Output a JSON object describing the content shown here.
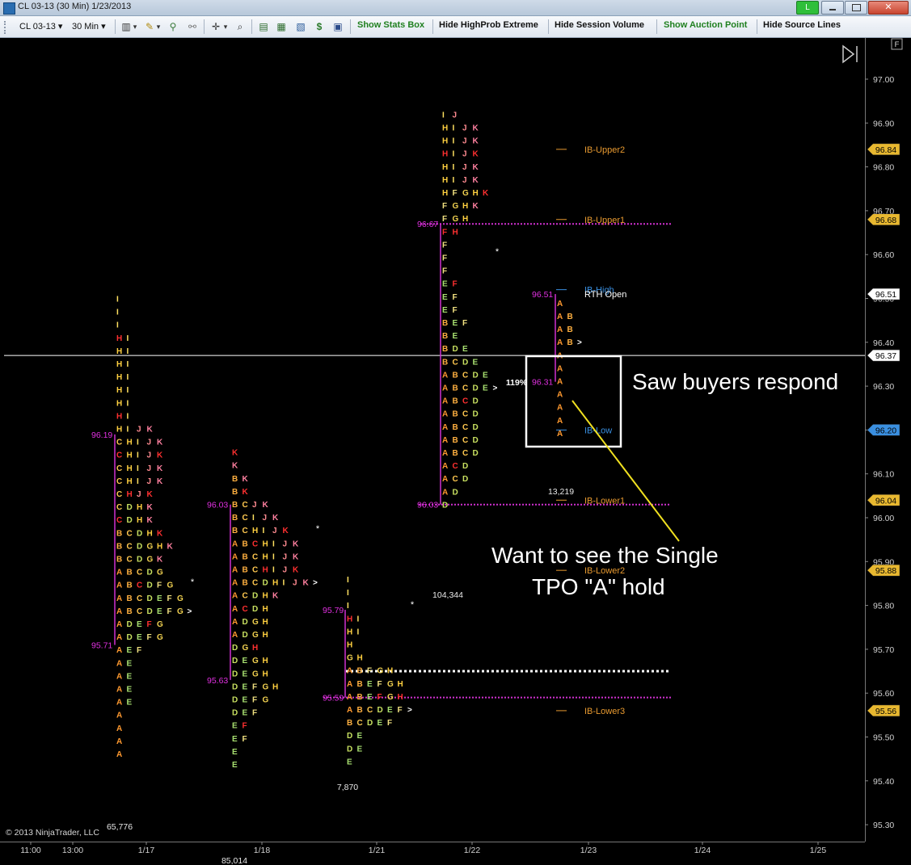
{
  "window": {
    "title": "CL 03-13 (30 Min)  1/23/2013",
    "status_button": "L"
  },
  "toolbar": {
    "instrument": "CL 03-13",
    "interval": "30 Min",
    "buttons": [
      {
        "label": "Show Stats Box",
        "color": "#208020"
      },
      {
        "label": "Hide HighProb Extreme",
        "color": "#111111"
      },
      {
        "label": "Hide Session Volume",
        "color": "#111111"
      },
      {
        "label": "Show Auction Point",
        "color": "#208020"
      },
      {
        "label": "Hide Source Lines",
        "color": "#111111"
      }
    ]
  },
  "chart": {
    "corner_label": "F",
    "copyright": "© 2013 NinjaTrader, LLC",
    "price_axis": {
      "min": 95.3,
      "max": 97.0,
      "step": 0.1,
      "labels": [
        "97.00",
        "96.90",
        "96.80",
        "96.70",
        "96.60",
        "96.50",
        "96.40",
        "96.30",
        "96.20",
        "96.10",
        "96.00",
        "95.90",
        "95.80",
        "95.70",
        "95.60",
        "95.50",
        "95.40",
        "95.30"
      ]
    },
    "price_badges": [
      {
        "text": "96.84",
        "price": 96.84,
        "color": "#e8b830"
      },
      {
        "text": "96.68",
        "price": 96.68,
        "color": "#e8b830"
      },
      {
        "text": "96.51",
        "price": 96.51,
        "color": "#ffffff"
      },
      {
        "text": "96.37",
        "price": 96.37,
        "color": "#ffffff"
      },
      {
        "text": "96.20",
        "price": 96.2,
        "color": "#3a8fe0"
      },
      {
        "text": "96.04",
        "price": 96.04,
        "color": "#e8b830"
      },
      {
        "text": "95.88",
        "price": 95.88,
        "color": "#e8b830"
      },
      {
        "text": "95.56",
        "price": 95.56,
        "color": "#e8b830"
      }
    ],
    "time_axis": [
      "11:00",
      "13:00",
      "1/17",
      "1/18",
      "1/21",
      "1/22",
      "1/23",
      "1/24",
      "1/25"
    ],
    "crosshair_price": 96.37,
    "reference_lines": [
      {
        "label": "IB-Upper2",
        "price": 96.84,
        "color": "#e89a30"
      },
      {
        "label": "IB-Upper1",
        "price": 96.68,
        "color": "#e89a30"
      },
      {
        "label": "IB-High",
        "price": 96.52,
        "color": "#3a8fe0"
      },
      {
        "label": "RTH Open",
        "price": 96.51,
        "color": "#ffffff"
      },
      {
        "label": "IB-Low",
        "price": 96.2,
        "color": "#3a8fe0"
      },
      {
        "label": "IB-Lower1",
        "price": 96.04,
        "color": "#e89a30"
      },
      {
        "label": "IB-Lower2",
        "price": 95.88,
        "color": "#e89a30"
      },
      {
        "label": "IB-Lower3",
        "price": 95.56,
        "color": "#e89a30"
      }
    ],
    "volumes": [
      "65,776",
      "85,014",
      "7,870",
      "104,344",
      "13,219"
    ],
    "value_labels": [
      "96.19",
      "95.71",
      "96.03",
      "95.63",
      "95.79",
      "95.59",
      "96.67",
      "96.03",
      "96.51",
      "96.31"
    ],
    "pct_label": "119%",
    "annotations": [
      "Saw buyers respond",
      "Want to see the Single",
      "TPO \"A\" hold"
    ]
  },
  "tpo_profiles": [
    {
      "top": 96.5,
      "rows": [
        "I",
        "I",
        "I",
        "HI",
        "HI",
        "HI",
        "HI",
        "HI",
        "HI",
        "HI",
        "HIJK",
        "CHIJK",
        "CHIJK",
        "CHIJK",
        "CHIJK",
        "CHJK",
        "CDHK",
        "CDHK",
        "BCDHK",
        "BCDGHK",
        "BCDGK",
        "ABCDG",
        "ABCDFG",
        "ABCDEFG",
        "ABCDEFG>",
        "ADEFG",
        "ADEFG",
        "AEF",
        "AE",
        "AE",
        "AE",
        "AE",
        "A",
        "A",
        "A",
        "A"
      ]
    },
    {
      "top": 96.15,
      "rows": [
        "K",
        "K",
        "BK",
        "BK",
        "BCJK",
        "BCIJK",
        "BCHIJK",
        "ABCHIJK",
        "ABCHIJK",
        "ABCHIJK",
        "ABCDHIJK>",
        "ACDHK",
        "ACDH",
        "ADGH",
        "ADGH",
        "DGH",
        "DEGH",
        "DEGH",
        "DEFGH",
        "DEFG",
        "DEF",
        "EF",
        "EF",
        "E",
        "E"
      ]
    },
    {
      "top": 95.86,
      "rows": [
        "I",
        "I",
        "I",
        "HI",
        "HI",
        "H",
        "GH",
        "ABFGH",
        "ABEFGH",
        "ABEFGH",
        "ABCDEF>",
        "BCDEF",
        "DE",
        "DE",
        "E"
      ]
    },
    {
      "top": 96.92,
      "rows": [
        "IJ",
        "HIJK",
        "HIJK",
        "HIJK",
        "HIJK",
        "HIJK",
        "HFGHK",
        "FGHK",
        "FGH",
        "FH",
        "F",
        "F",
        "F",
        "EF",
        "EF",
        "EF",
        "BEF",
        "BE",
        "BDE",
        "BCDE",
        "ABCDE",
        "ABCDE>",
        "ABCD",
        "ABCD",
        "ABCD",
        "ABCD",
        "ABCD",
        "ACD",
        "ACD",
        "AD",
        "D"
      ]
    },
    {
      "top": 96.49,
      "rows": [
        "A",
        "AB",
        "AB",
        "AB>",
        "A",
        "A",
        "A",
        "A",
        "A",
        "A",
        "A"
      ]
    }
  ]
}
